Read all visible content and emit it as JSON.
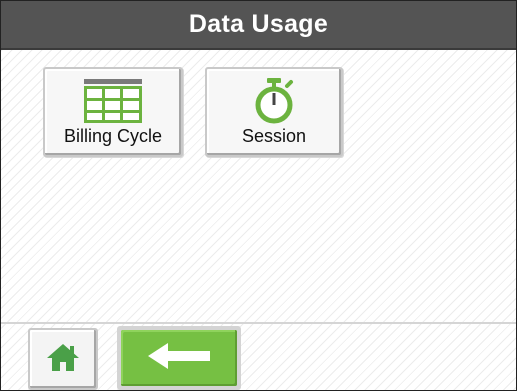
{
  "header": {
    "title": "Data Usage"
  },
  "tiles": [
    {
      "label": "Billing Cycle",
      "icon": "table-grid-icon"
    },
    {
      "label": "Session",
      "icon": "stopwatch-icon"
    }
  ],
  "footer": {
    "home_icon": "home-icon",
    "back_icon": "back-arrow-icon"
  },
  "colors": {
    "header_bg": "#545454",
    "accent_green": "#76c043",
    "icon_green": "#6cb33f"
  }
}
